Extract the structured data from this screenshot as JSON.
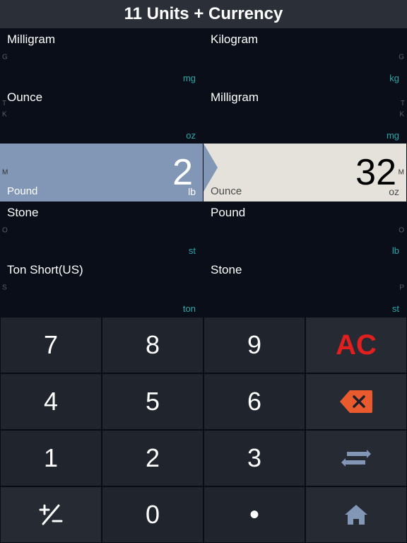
{
  "header": {
    "title": "11 Units + Currency"
  },
  "units": {
    "left": [
      {
        "name": "Milligram",
        "abbrev": "mg",
        "sideLetter": "G"
      },
      {
        "name": "Ounce",
        "abbrev": "oz",
        "sideLetter": "K"
      },
      {
        "name": "Pound",
        "abbrev": "lb",
        "sideLetter": "M",
        "value": "2",
        "selected": true
      },
      {
        "name": "Stone",
        "abbrev": "st",
        "sideLetter": "O"
      },
      {
        "name": "Ton Short(US)",
        "abbrev": "ton",
        "sideLetter": "S"
      }
    ],
    "right": [
      {
        "name": "Kilogram",
        "abbrev": "kg",
        "sideLetter": "G"
      },
      {
        "name": "Milligram",
        "abbrev": "mg",
        "sideLetter": "K"
      },
      {
        "name": "Ounce",
        "abbrev": "oz",
        "sideLetter": "M",
        "value": "32",
        "selected": true
      },
      {
        "name": "Pound",
        "abbrev": "lb",
        "sideLetter": "O"
      },
      {
        "name": "Stone",
        "abbrev": "st",
        "sideLetter": "P"
      }
    ],
    "bottomSideLetterLeft": "T",
    "bottomSideLetterRight": "T"
  },
  "keypad": {
    "k7": "7",
    "k8": "8",
    "k9": "9",
    "ac": "AC",
    "k4": "4",
    "k5": "5",
    "k6": "6",
    "k1": "1",
    "k2": "2",
    "k3": "3",
    "k0": "0",
    "dot": "•"
  }
}
